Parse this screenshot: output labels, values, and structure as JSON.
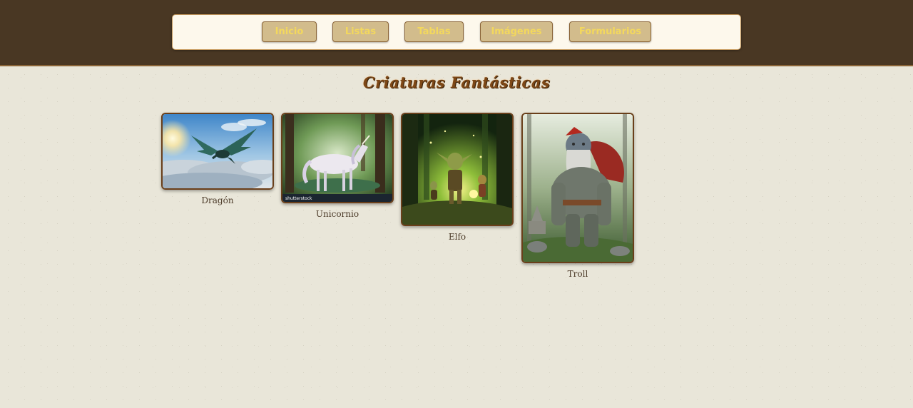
{
  "nav": {
    "items": [
      {
        "label": "Inicio"
      },
      {
        "label": "Listas"
      },
      {
        "label": "Tablas"
      },
      {
        "label": "Imágenes"
      },
      {
        "label": "Formularios"
      }
    ]
  },
  "main": {
    "title": "Criaturas Fantásticas"
  },
  "gallery": {
    "items": [
      {
        "caption": "Dragón",
        "image": "dragon-image"
      },
      {
        "caption": "Unicornio",
        "image": "unicorn-image",
        "watermark": "shutterstock"
      },
      {
        "caption": "Elfo",
        "image": "elf-image"
      },
      {
        "caption": "Troll",
        "image": "troll-image"
      }
    ]
  },
  "colors": {
    "header_bg": "#493723",
    "nav_bg": "#fdf8ec",
    "button_bg": "#d2bc8c",
    "button_text": "#f3d85d",
    "title_color": "#7d4716",
    "frame_border": "#6a3f1a",
    "page_bg": "#e9e6d9"
  }
}
